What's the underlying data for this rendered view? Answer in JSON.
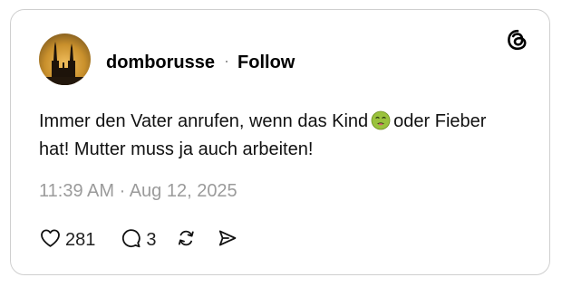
{
  "post": {
    "username": "domborusse",
    "separator": "·",
    "follow_label": "Follow",
    "text_before_emoji": "Immer den Vater anrufen, wenn das Kind",
    "emoji": "nauseated-face-emoji",
    "text_after_emoji": "oder Fieber hat! Mutter muss ja auch arbeiten!",
    "timestamp": "11:39 AM · Aug 12, 2025",
    "likes": "281",
    "replies": "3"
  },
  "icons": {
    "brand": "threads-logo-icon",
    "like": "heart-icon",
    "reply": "speech-bubble-icon",
    "repost": "repost-icon",
    "share": "send-icon"
  },
  "colors": {
    "text": "#000000",
    "muted": "#9b9b9b",
    "border": "#cfcfcf",
    "emoji_face": "#9ac23c"
  }
}
